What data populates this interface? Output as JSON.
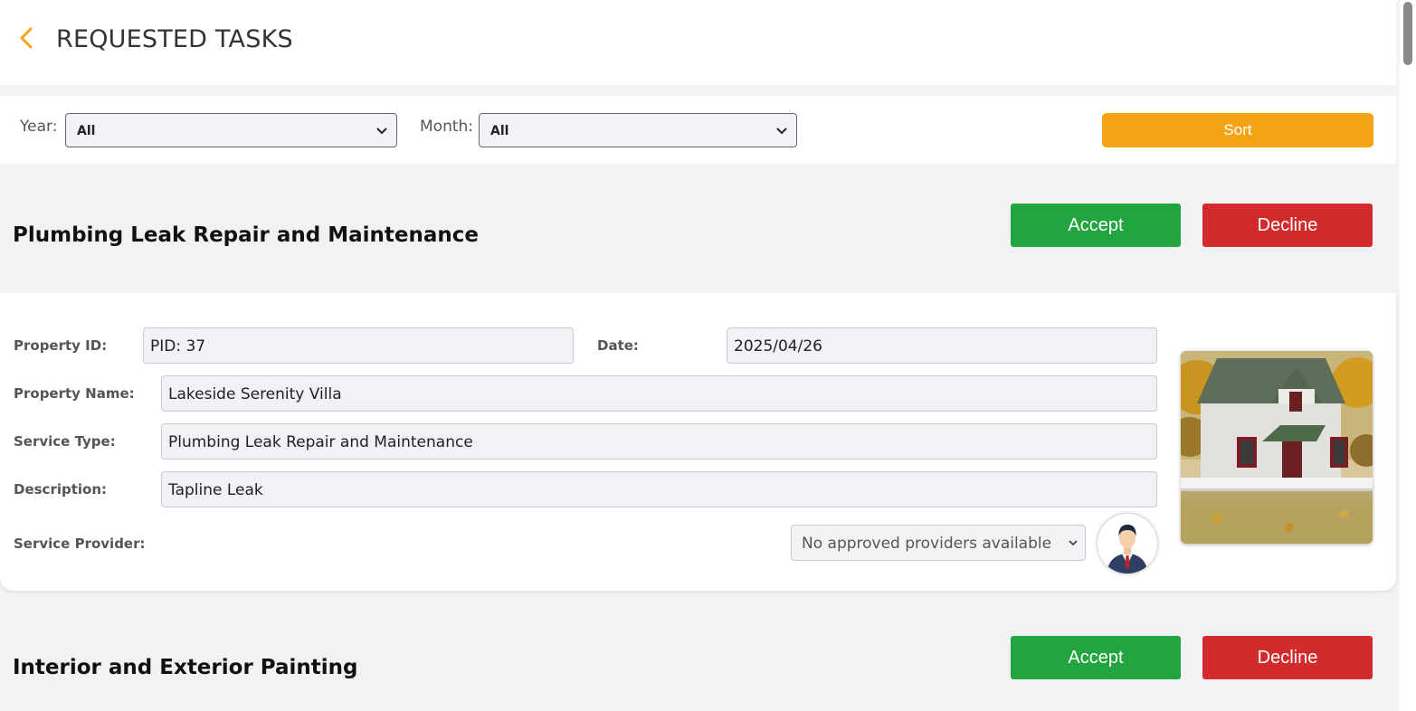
{
  "header": {
    "title": "REQUESTED TASKS"
  },
  "filters": {
    "year_label": "Year:",
    "year_value": "All",
    "month_label": "Month:",
    "month_value": "All",
    "sort_label": "Sort"
  },
  "tasks": [
    {
      "title": "Plumbing Leak Repair and Maintenance",
      "accept_label": "Accept",
      "decline_label": "Decline",
      "property_id_label": "Property ID:",
      "property_id": "PID: 37",
      "date_label": "Date:",
      "date": "2025/04/26",
      "property_name_label": "Property Name:",
      "property_name": "Lakeside Serenity Villa",
      "service_type_label": "Service Type:",
      "service_type": "Plumbing Leak Repair and Maintenance",
      "description_label": "Description:",
      "description": "Tapline Leak",
      "service_provider_label": "Service Provider:",
      "service_provider_value": "No approved providers available"
    },
    {
      "title": "Interior and Exterior Painting",
      "accept_label": "Accept",
      "decline_label": "Decline"
    }
  ],
  "colors": {
    "accent": "#f6a313",
    "accept": "#22a43e",
    "decline": "#d12b2b"
  }
}
